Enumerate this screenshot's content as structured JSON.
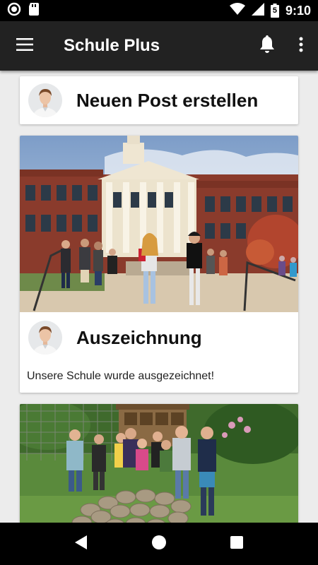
{
  "app": {
    "title": "Schule Plus"
  },
  "status_bar": {
    "time": "9:10",
    "battery_level": "5"
  },
  "composer": {
    "label": "Neuen Post erstellen"
  },
  "posts": [
    {
      "title": "Auszeichnung",
      "text": "Unsere Schule wurde ausgezeichnet!"
    },
    {
      "title": "",
      "text": ""
    }
  ],
  "colors": {
    "appbar": "#222222",
    "statusbar": "#000000",
    "background": "#ececec"
  },
  "icons": {
    "menu": "hamburger-icon",
    "notifications": "bell-icon",
    "overflow": "more-vert-icon",
    "nav_back": "back-triangle-icon",
    "nav_home": "home-circle-icon",
    "nav_recents": "recents-square-icon"
  }
}
